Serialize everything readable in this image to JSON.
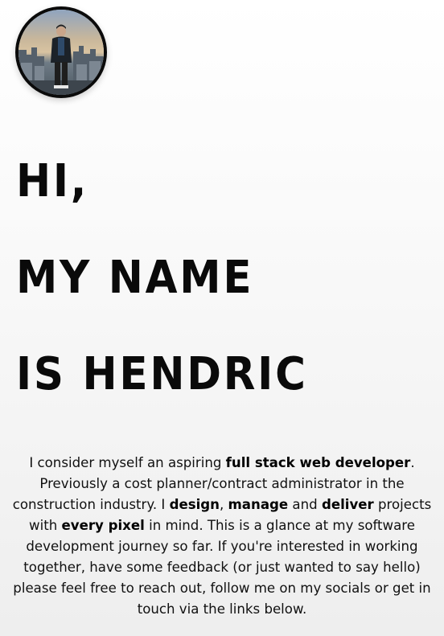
{
  "profile": {
    "avatar_alt": "Profile photo"
  },
  "hero": {
    "line1": "HI,",
    "line2": "MY NAME",
    "line3": "IS HENDRIC"
  },
  "bio": {
    "p1": "I consider myself an aspiring ",
    "b1": "full stack web developer",
    "p2": ". Previously a cost planner/contract administrator in the construction industry. I ",
    "b2": "design",
    "p3": ", ",
    "b3": "manage",
    "p4": " and ",
    "b4": "deliver",
    "p5": " projects with ",
    "b5": "every pixel",
    "p6": " in mind. This is a glance at my software development journey so far. If you're interested in working together, have some feedback (or just wanted to say hello) please feel free to reach out, follow me on my socials or get in touch via the links below."
  },
  "colors": {
    "text": "#111111",
    "avatar_border": "#0b0b0b",
    "background_top": "#ffffff",
    "background_bottom": "#eeeeee"
  }
}
